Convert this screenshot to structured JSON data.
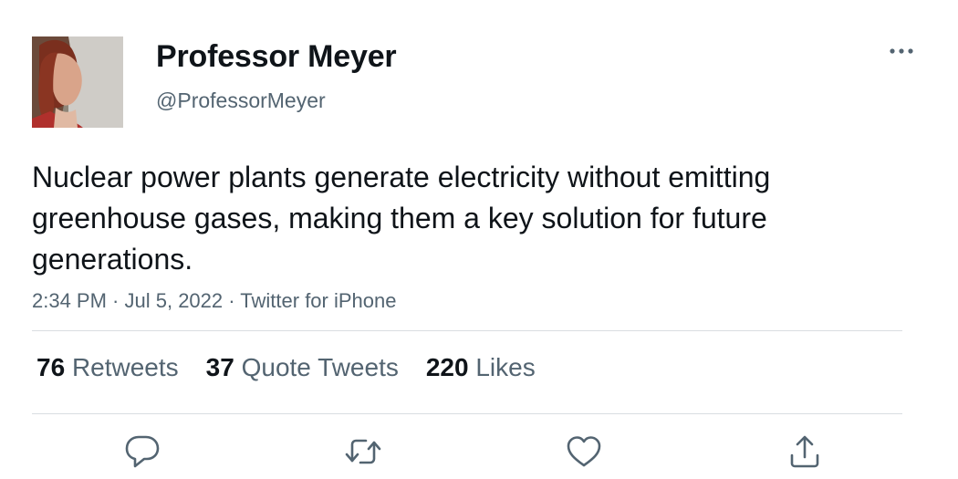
{
  "author": {
    "display_name": "Professor Meyer",
    "handle": "@ProfessorMeyer"
  },
  "tweet": {
    "text": "Nuclear power plants generate electricity without emitting greenhouse gases, making them a key solution for future generations.",
    "time": "2:34 PM",
    "date": "Jul 5, 2022",
    "source": "Twitter for iPhone",
    "separator": " · "
  },
  "stats": {
    "retweets": {
      "count": "76",
      "label": "Retweets"
    },
    "quote_tweets": {
      "count": "37",
      "label": "Quote Tweets"
    },
    "likes": {
      "count": "220",
      "label": "Likes"
    }
  },
  "icons": {
    "more": "more-horizontal-icon",
    "reply": "reply-icon",
    "retweet": "retweet-icon",
    "like": "heart-icon",
    "share": "share-icon"
  },
  "colors": {
    "text_primary": "#0f1419",
    "text_secondary": "#536471",
    "divider": "#d9dde1",
    "icon": "#536471"
  }
}
